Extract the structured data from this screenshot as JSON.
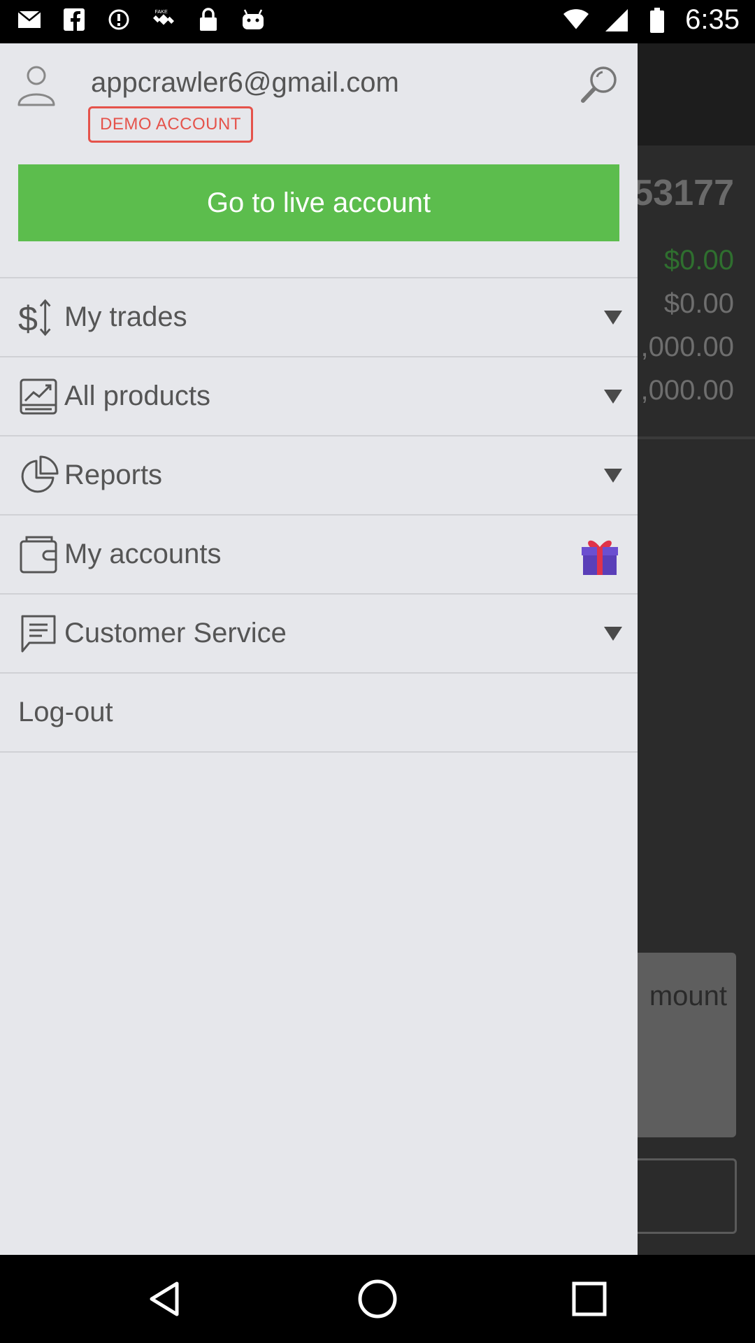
{
  "status_bar": {
    "time": "6:35",
    "icons": [
      "mail-icon",
      "facebook-icon",
      "alert-circle-icon",
      "fake-gps-icon",
      "lock-icon",
      "android-icon",
      "wifi-icon",
      "signal-icon",
      "battery-icon"
    ]
  },
  "background": {
    "account_number": "53177",
    "amounts": [
      "$0.00",
      "$0.00",
      ",000.00",
      ",000.00"
    ],
    "panel_label": "mount"
  },
  "drawer": {
    "email": "appcrawler6@gmail.com",
    "demo_badge": "DEMO ACCOUNT",
    "live_button": "Go to live account",
    "menu": [
      {
        "label": "My trades",
        "icon": "dollar-arrows-icon"
      },
      {
        "label": "All products",
        "icon": "chart-icon"
      },
      {
        "label": "Reports",
        "icon": "pie-chart-icon"
      },
      {
        "label": "My accounts",
        "icon": "wallet-icon"
      },
      {
        "label": "Customer Service",
        "icon": "chat-icon"
      }
    ],
    "logout": "Log-out"
  },
  "colors": {
    "drawer_bg": "#e6e7eb",
    "live_button": "#5cbd4d",
    "demo_badge": "#e5534b"
  }
}
